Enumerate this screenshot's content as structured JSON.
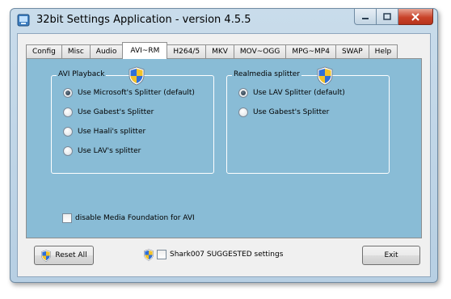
{
  "window": {
    "title": "32bit Settings Application - version 4.5.5"
  },
  "tabs": [
    "Config",
    "Misc",
    "Audio",
    "AVI~RM",
    "H264/5",
    "MKV",
    "MOV~OGG",
    "MPG~MP4",
    "SWAP",
    "Help"
  ],
  "active_tab": "AVI~RM",
  "avi_group": {
    "title": "AVI Playback",
    "options": [
      "Use Microsoft's Splitter (default)",
      "Use Gabest's Splitter",
      "Use Haali's splitter",
      "Use LAV's splitter"
    ],
    "selected": 0
  },
  "rm_group": {
    "title": "Realmedia splitter",
    "options": [
      "Use LAV Splitter (default)",
      "Use Gabest's Splitter"
    ],
    "selected": 0
  },
  "mf_checkbox": {
    "label": "disable Media Foundation for AVI",
    "checked": false
  },
  "footer": {
    "reset_label": "Reset All",
    "suggested_label": "Shark007 SUGGESTED settings",
    "suggested_checked": false,
    "exit_label": "Exit"
  },
  "icons": [
    "app-icon",
    "shield-icon",
    "minimize-icon",
    "maximize-icon",
    "close-icon"
  ]
}
